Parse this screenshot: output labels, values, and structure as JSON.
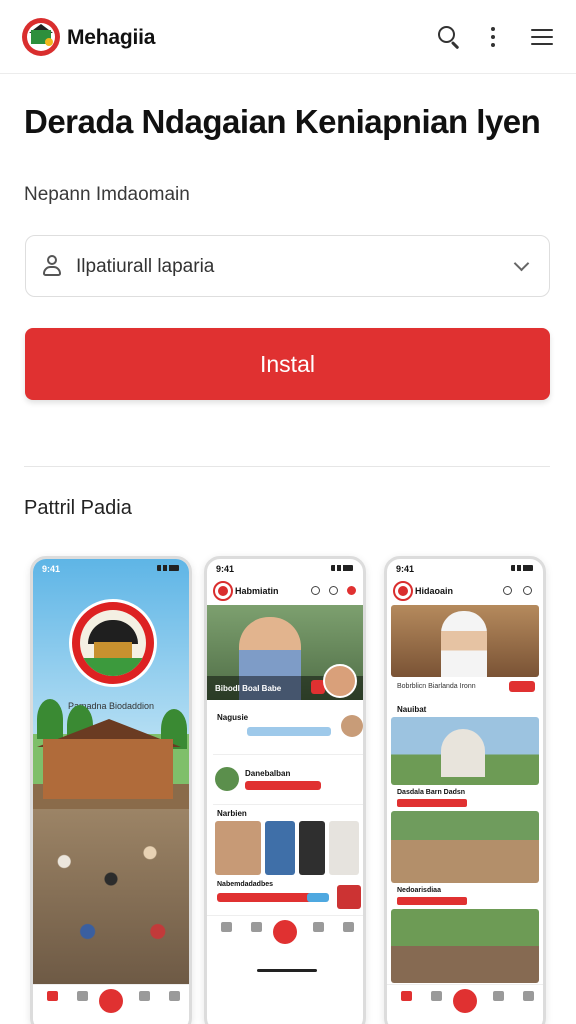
{
  "app": {
    "name": "Mehagiia"
  },
  "header": {
    "headline": "Derada Ndagaian Keniapnian lyen",
    "subhead": "Nepann Imdaomain"
  },
  "form": {
    "field_value": "Ilpatiurall laparia"
  },
  "actions": {
    "install_label": "Instal"
  },
  "preview": {
    "section_title": "Pattril Padia",
    "phone1": {
      "caption": "Pamadna Biodaddion"
    },
    "phone2": {
      "app_name": "Habmiatin",
      "hero_text": "Bibodl Boal Babe",
      "card1_title": "Nagusie",
      "card2_title": "Danebalban",
      "news_label": "Narbien",
      "footer_title": "Nabemdadadbes"
    },
    "phone3": {
      "app_name": "Hidaoain",
      "video_caption": "Bobrblicn Biarlanda Ironn",
      "section_label": "Nauibat",
      "img1_caption": "Dasdala Barn Dadsn",
      "img2_caption": "Nedoarisdiaa"
    }
  },
  "colors": {
    "accent": "#e03131",
    "brand_green": "#2d8f3c"
  },
  "icons": [
    "search-icon",
    "more-vert-icon",
    "menu-icon",
    "user-icon",
    "chevron-down-icon"
  ]
}
